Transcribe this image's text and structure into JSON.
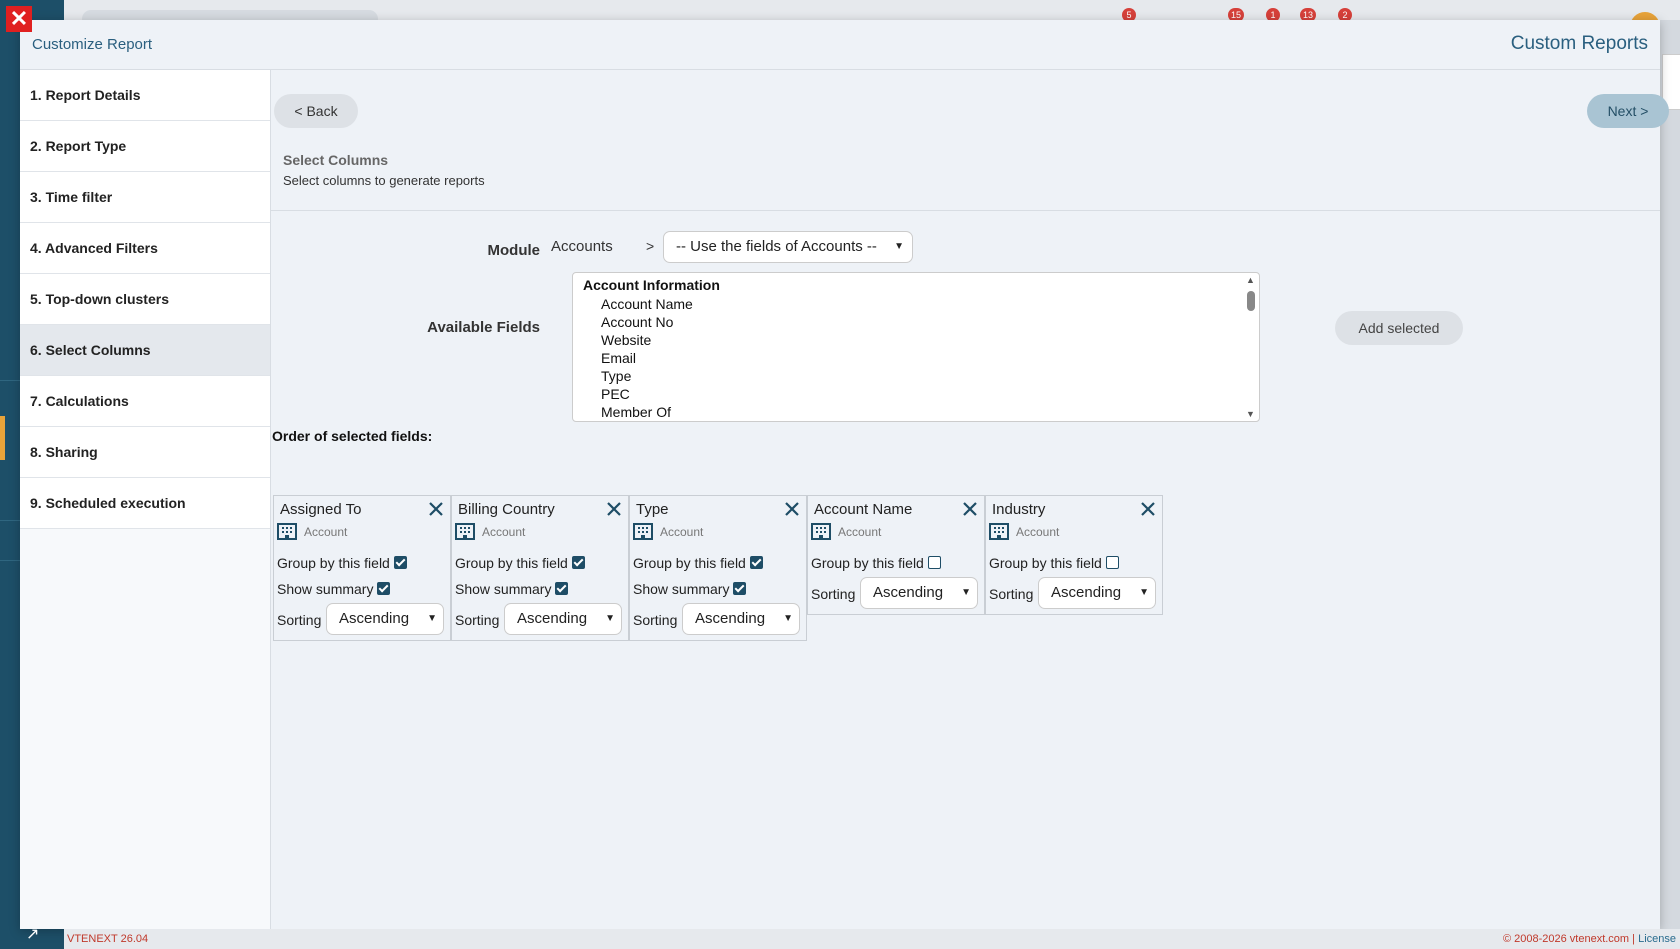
{
  "app": {
    "version": "VTENEXT 26.04",
    "copyright": "© 2008-2026 vtenext.com",
    "license_link": "License",
    "badges": [
      "5",
      "15",
      "1",
      "13",
      "2"
    ]
  },
  "modal": {
    "title": "Customize Report",
    "right_title": "Custom Reports",
    "close_symbol": "✕"
  },
  "steps": [
    {
      "label": "1. Report Details"
    },
    {
      "label": "2. Report Type"
    },
    {
      "label": "3. Time filter"
    },
    {
      "label": "4. Advanced Filters"
    },
    {
      "label": "5. Top-down clusters"
    },
    {
      "label": "6. Select Columns",
      "active": true
    },
    {
      "label": "7. Calculations"
    },
    {
      "label": "8. Sharing"
    },
    {
      "label": "9. Scheduled execution"
    }
  ],
  "nav": {
    "back": "< Back",
    "next": "Next >"
  },
  "section": {
    "title": "Select Columns",
    "subtitle": "Select columns to generate reports"
  },
  "module": {
    "label": "Module",
    "value": "Accounts",
    "separator": ">",
    "select_value": "-- Use the fields of Accounts --"
  },
  "available": {
    "label": "Available Fields",
    "group": "Account Information",
    "options": [
      "Account Name",
      "Account No",
      "Website",
      "Email",
      "Type",
      "PEC",
      "Member Of"
    ]
  },
  "add_selected": "Add selected",
  "order_label": "Order of selected fields:",
  "labels": {
    "group_by": "Group by this field",
    "show_summary": "Show summary",
    "sorting": "Sorting"
  },
  "columns": [
    {
      "name": "Assigned To",
      "module": "Account",
      "group_by": true,
      "show_summary": true,
      "sorting": "Ascending"
    },
    {
      "name": "Billing Country",
      "module": "Account",
      "group_by": true,
      "show_summary": true,
      "sorting": "Ascending"
    },
    {
      "name": "Type",
      "module": "Account",
      "group_by": true,
      "show_summary": true,
      "sorting": "Ascending"
    },
    {
      "name": "Account Name",
      "module": "Account",
      "group_by": false,
      "sorting": "Ascending"
    },
    {
      "name": "Industry",
      "module": "Account",
      "group_by": false,
      "sorting": "Ascending"
    }
  ],
  "colors": {
    "accent": "#1e4d66",
    "close": "#e02020",
    "badge": "#d6403a"
  }
}
